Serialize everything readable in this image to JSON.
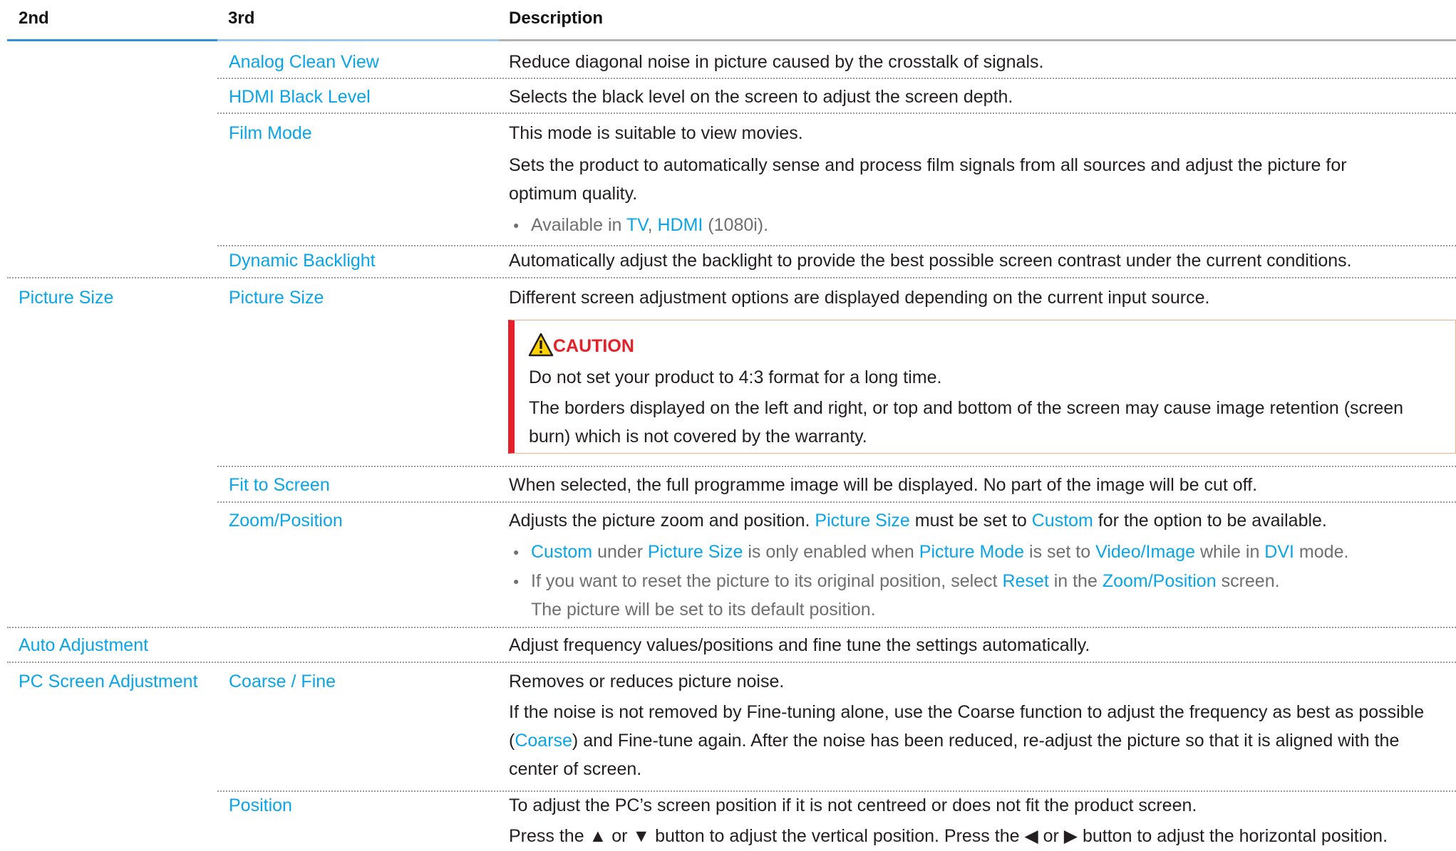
{
  "header": {
    "col1": "2nd",
    "col2": "3rd",
    "col3": "Description"
  },
  "rows": {
    "analog": {
      "third": "Analog Clean View",
      "desc": "Reduce diagonal noise in picture caused by the crosstalk of signals."
    },
    "hdmi": {
      "third": "HDMI Black Level",
      "desc": "Selects the black level on the screen to adjust the screen depth."
    },
    "film": {
      "third": "Film Mode",
      "desc1": "This mode is suitable to view movies.",
      "desc2a": "Sets the product to automatically sense and process film signals from all sources and adjust the picture for",
      "desc2b": "optimum quality.",
      "note_prefix": "Available in ",
      "note_tv": "TV",
      "note_sep": ", ",
      "note_hdmi": "HDMI",
      "note_suffix": " (1080i)."
    },
    "dynamic": {
      "third": "Dynamic Backlight",
      "desc": "Automatically adjust the backlight to provide the best possible screen contrast under the current conditions."
    },
    "picsize": {
      "second": "Picture Size",
      "third": "Picture Size",
      "desc": "Different screen adjustment options are displayed depending on the current input source.",
      "caution_title": "CAUTION",
      "caution1": "Do not set your product to 4:3 format for a long time.",
      "caution2a": "The borders displayed on the left and right, or top and bottom of the screen may cause image retention (screen",
      "caution2b": "burn) which is not covered by the warranty."
    },
    "fit": {
      "third": "Fit to Screen",
      "desc": "When selected, the full programme image will be displayed. No part of the image will be cut off."
    },
    "zoom": {
      "third": "Zoom/Position",
      "d_a": "Adjusts the picture zoom and position. ",
      "d_b": "Picture Size",
      "d_c": " must be set to ",
      "d_d": "Custom",
      "d_e": " for the option to be available.",
      "n1_a": "Custom",
      "n1_b": " under ",
      "n1_c": "Picture Size",
      "n1_d": " is only enabled when ",
      "n1_e": "Picture Mode",
      "n1_f": " is set to ",
      "n1_g": "Video/Image",
      "n1_h": " while in ",
      "n1_i": "DVI",
      "n1_j": " mode.",
      "n2_a": "If you want to reset the picture to its original position, select ",
      "n2_b": "Reset",
      "n2_c": " in the ",
      "n2_d": "Zoom/Position",
      "n2_e": " screen.",
      "n2_f": "The picture will be set to its default position."
    },
    "auto": {
      "second": "Auto Adjustment",
      "desc": "Adjust frequency values/positions and fine tune the settings automatically."
    },
    "pcscreen": {
      "second": "PC Screen Adjustment",
      "third": "Coarse / Fine",
      "desc1": "Removes or reduces picture noise.",
      "desc2": "If the noise is not removed by Fine-tuning alone, use the Coarse function to adjust the frequency as best as possible",
      "desc3a": "(",
      "desc3b": "Coarse",
      "desc3c": ") and Fine-tune again. After the noise has been reduced, re-adjust the picture so that it is aligned with the",
      "desc4": "center of screen."
    },
    "position": {
      "third": "Position",
      "desc1": "To adjust the PC’s screen position if it is not centreed or does not fit the product screen.",
      "desc2": "Press the ▲ or ▼ button to adjust the vertical position. Press the ◀ or ▶ button to adjust the horizontal position."
    }
  }
}
